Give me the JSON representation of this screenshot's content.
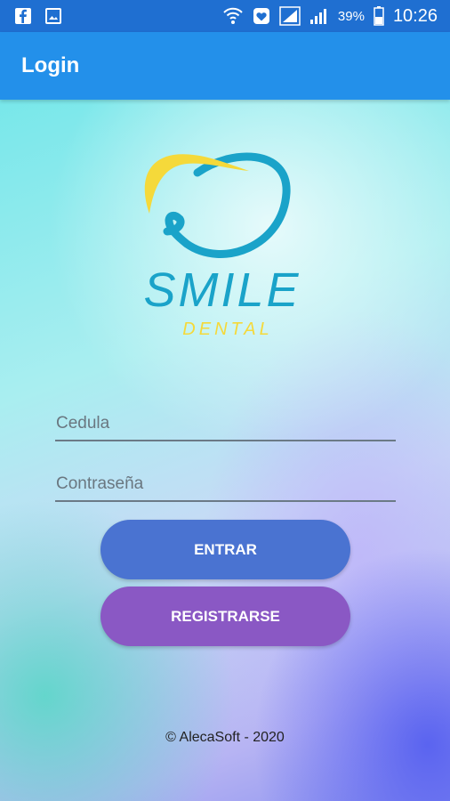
{
  "status_bar": {
    "left_icons": [
      "facebook-icon",
      "gallery-icon"
    ],
    "right_icons": [
      "wifi-icon",
      "heart-notification-icon",
      "signal-icon",
      "signal-bars-icon",
      "battery-icon"
    ],
    "battery_percent": "39%",
    "time": "10:26"
  },
  "app_bar": {
    "title": "Login"
  },
  "logo": {
    "brand_name": "SMILE",
    "brand_subtitle": "DENTAL"
  },
  "form": {
    "cedula_placeholder": "Cedula",
    "cedula_value": "",
    "password_placeholder": "Contraseña",
    "password_value": "",
    "login_button": "ENTRAR",
    "register_button": "REGISTRARSE"
  },
  "footer": {
    "copyright": "© AlecaSoft - 2020"
  },
  "colors": {
    "status_bar": "#1f6fd1",
    "app_bar": "#2390ea",
    "login_button": "#4a73d1",
    "register_button": "#8a58c4",
    "logo_blue": "#1aa3c9",
    "logo_yellow": "#f5d93a"
  }
}
